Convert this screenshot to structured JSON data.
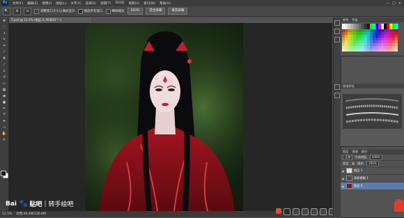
{
  "app": {
    "logo": "Ps"
  },
  "menu": [
    "文件(F)",
    "编辑(E)",
    "图像(I)",
    "图层(L)",
    "文字(Y)",
    "选择(S)",
    "滤镜(T)",
    "3D(D)",
    "视图(V)",
    "窗口(W)",
    "帮助(H)"
  ],
  "window_controls": [
    "—",
    "□",
    "✕"
  ],
  "options_bar": {
    "zoom_icons": [
      "🔍",
      "⊕",
      "⊖"
    ],
    "resize_windows": "调整窗口大小以满屏显示",
    "zoom_all": "缩放所有窗口",
    "scrubby_zoom": "细微缩放",
    "zoom_value": "100%",
    "fit_screen": "适合屏幕",
    "fill_screen": "填充屏幕"
  },
  "document": {
    "tab_title": "1.psd @ 12.5% (图层 0, RGB/8) *",
    "close": "×"
  },
  "status": {
    "zoom": "12.5%",
    "doc_size": "文档:49.4M/130.6M"
  },
  "panels": {
    "color_tabs": [
      "颜色",
      "色板"
    ],
    "brush_tabs": [
      "画笔预设"
    ],
    "layers_tabs": [
      "图层",
      "通道",
      "路径"
    ],
    "blend_mode": "正常",
    "opacity_label": "不透明度:",
    "opacity_value": "100%",
    "lock_label": "锁定:",
    "fill_label": "填充:",
    "fill_value": "100%",
    "layers": [
      {
        "name": "图层 1",
        "selected": false
      },
      {
        "name": "高斯模糊 1",
        "selected": false
      },
      {
        "name": "图层 0",
        "selected": true
      }
    ]
  },
  "watermark": {
    "brand": "Bai",
    "brand2": "贴吧",
    "sep": "|",
    "text": "转手绘吧"
  },
  "colors": {
    "accent_layer": "#5a7dad",
    "badge": "#e23c2b"
  }
}
